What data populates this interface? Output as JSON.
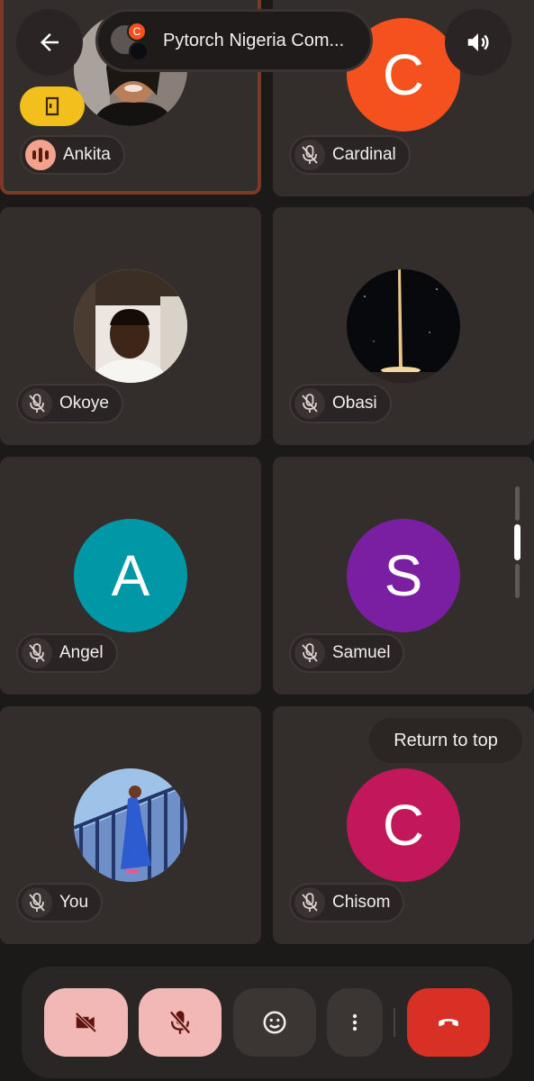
{
  "header": {
    "meeting_title": "Pytorch Nigeria Com...",
    "back_icon": "arrow-back-icon",
    "speaker_icon": "volume-icon",
    "group_badge_letter": "C"
  },
  "participants": [
    {
      "name": "Ankita",
      "avatar_type": "photo",
      "muted": false,
      "speaking": true
    },
    {
      "name": "Cardinal",
      "avatar_type": "letter",
      "letter": "C",
      "color": "#f4511e",
      "muted": true
    },
    {
      "name": "Okoye",
      "avatar_type": "photo",
      "muted": true
    },
    {
      "name": "Obasi",
      "avatar_type": "photo",
      "muted": true
    },
    {
      "name": "Angel",
      "avatar_type": "letter",
      "letter": "A",
      "color": "#0097a7",
      "muted": true
    },
    {
      "name": "Samuel",
      "avatar_type": "letter",
      "letter": "S",
      "color": "#7b1fa2",
      "muted": true
    },
    {
      "name": "You",
      "avatar_type": "illustration",
      "muted": true
    },
    {
      "name": "Chisom",
      "avatar_type": "letter",
      "letter": "C",
      "color": "#c2185b",
      "muted": true
    }
  ],
  "return_to_top": "Return to top",
  "controls": {
    "camera": "camera-off-icon",
    "mic": "mic-off-icon",
    "reactions": "emoji-icon",
    "more": "more-vert-icon",
    "end_call": "end-call-icon"
  },
  "colors": {
    "background": "#1c1a19",
    "tile": "#332d2b",
    "active_speaker_border": "#7a3a25",
    "toggle_off_bg": "#f2b8b5",
    "end_call": "#d93025",
    "exit_chip": "#f2bf1c"
  }
}
